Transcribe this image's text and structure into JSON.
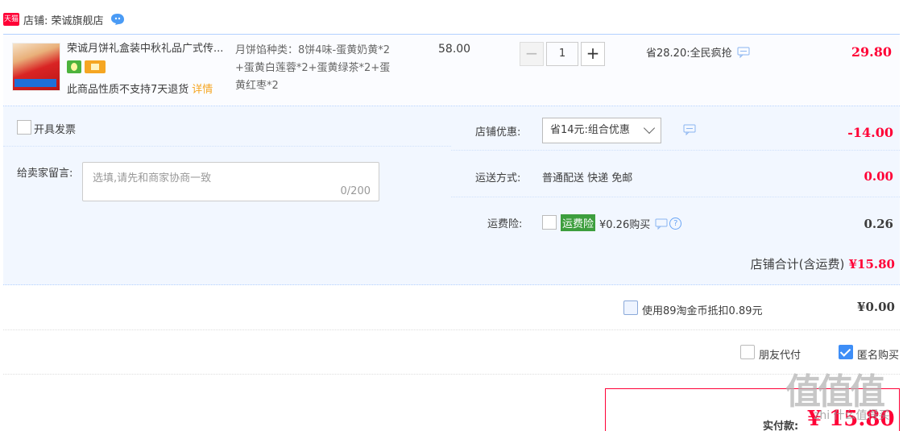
{
  "store": {
    "badge": "天猫",
    "name": "店铺: 荣诚旗舰店"
  },
  "item": {
    "title": "荣诚月饼礼盒装中秋礼品广式传...",
    "no_return": "此商品性质不支持7天退货",
    "details_link": "详情",
    "sku_lines": [
      "月饼馅种类：8饼4味-蛋黄奶黄*2",
      "+蛋黄白莲蓉*2+蛋黄绿茶*2+蛋",
      "黄红枣*2"
    ],
    "unit_price": "58.00",
    "quantity": "1",
    "qty_minus": "−",
    "qty_plus": "+",
    "promo": "省28.20:全民疯抢",
    "total": "29.80"
  },
  "options": {
    "invoice_label": "开具发票",
    "message_label": "给卖家留言:",
    "message_placeholder": "选填,请先和商家协商一致",
    "message_count": "0/200",
    "store_discount_label": "店铺优惠:",
    "store_discount_select": "省14元:组合优惠",
    "store_discount_value": "-14.00",
    "shipping_label": "运送方式:",
    "shipping_method": "普通配送 快递 免邮",
    "shipping_value": "0.00",
    "insurance_label": "运费险:",
    "insurance_tag": "运费险",
    "insurance_text": "¥0.26购买",
    "insurance_help": "?",
    "insurance_value": "0.26",
    "store_total_label": "店铺合计(含运费)",
    "store_total_value": "¥15.80"
  },
  "coins": {
    "label": "使用89淘金币抵扣0.89元",
    "value": "¥0.00"
  },
  "extras": {
    "friend_pay_label": "朋友代付",
    "anonymous_label": "匿名购买",
    "anonymous_checked": true
  },
  "pay": {
    "label": "实付款:",
    "value": "¥ 15.80"
  },
  "watermark": {
    "logo": "值值值",
    "url": "zhi 什么值得买"
  },
  "colors": {
    "accent_red": "#ff0036",
    "blue_border": "#b2d1ff",
    "option_bg": "#f2f7ff"
  }
}
